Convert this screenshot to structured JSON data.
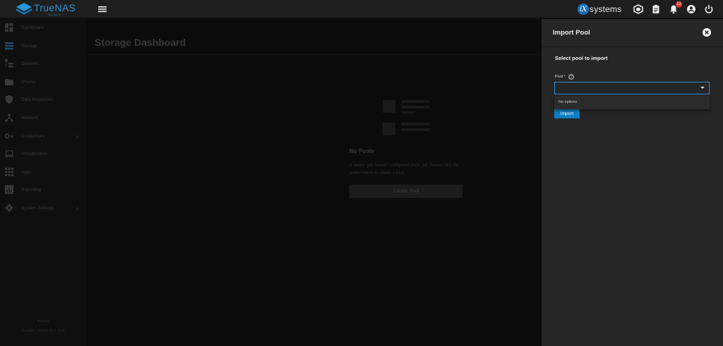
{
  "header": {
    "logo_name": "TrueNAS",
    "logo_sub": "SCALE",
    "vendor_badge": "iX",
    "vendor_text": "systems",
    "notifications_count": "12",
    "icons": [
      "menu-icon",
      "truecommand-icon",
      "clipboard-icon",
      "bell-icon",
      "account-icon",
      "power-icon"
    ]
  },
  "sidebar": {
    "items": [
      {
        "label": "Dashboard",
        "icon": "dashboard-icon"
      },
      {
        "label": "Storage",
        "icon": "storage-icon"
      },
      {
        "label": "Datasets",
        "icon": "datasets-icon"
      },
      {
        "label": "Shares",
        "icon": "shares-icon"
      },
      {
        "label": "Data Protection",
        "icon": "shield-icon"
      },
      {
        "label": "Network",
        "icon": "network-icon"
      },
      {
        "label": "Credentials",
        "icon": "key-icon",
        "has_submenu": true
      },
      {
        "label": "Virtualization",
        "icon": "laptop-icon"
      },
      {
        "label": "Apps",
        "icon": "apps-icon"
      },
      {
        "label": "Reporting",
        "icon": "reporting-icon"
      },
      {
        "label": "System Settings",
        "icon": "gear-icon",
        "has_submenu": true
      }
    ],
    "footer_hostname": "truenas",
    "footer_version": "TrueNAS SCALE ® © 2024"
  },
  "main": {
    "title": "Storage Dashboard",
    "empty_title": "No Pools",
    "empty_message": "It seems you haven't configured pools yet. Please click the button below to create a pool.",
    "create_button": "Create Pool"
  },
  "panel": {
    "title": "Import Pool",
    "section_title": "Select pool to import",
    "pool_label": "Pool *",
    "pool_value": "",
    "dropdown_option": "No options",
    "import_button": "Import"
  },
  "colors": {
    "accent": "#0d7fc4",
    "brand": "#2a97d8",
    "notification": "#d9342b"
  }
}
